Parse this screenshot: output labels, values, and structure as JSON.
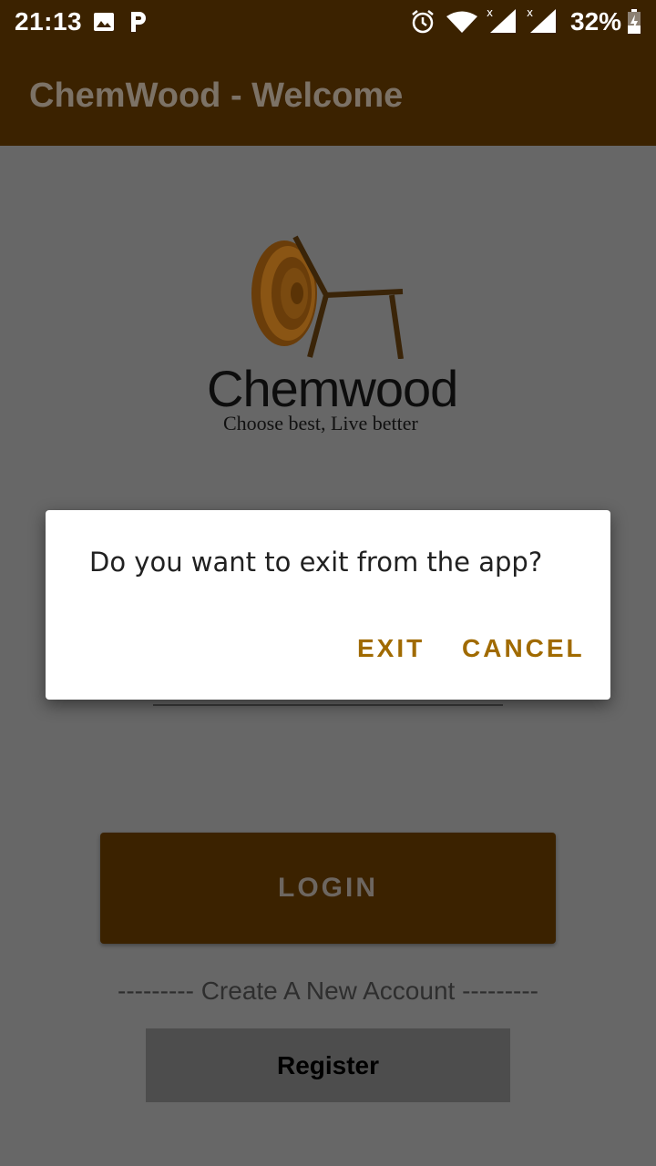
{
  "status_bar": {
    "time": "21:13",
    "battery_percent": "32%",
    "icons": [
      "image-icon",
      "parking-app-icon",
      "alarm-icon",
      "wifi-icon",
      "signal-icon",
      "signal-icon",
      "battery-charging-icon"
    ]
  },
  "app_bar": {
    "title": "ChemWood - Welcome"
  },
  "logo": {
    "wordmark": "Chemwood",
    "tagline": "Choose best, Live better"
  },
  "login": {
    "button_label": "LOGIN"
  },
  "create_account": {
    "text": "--------- Create A New Account ---------"
  },
  "register": {
    "button_label": "Register"
  },
  "dialog": {
    "message": "Do you want to exit from the app?",
    "exit_label": "EXIT",
    "cancel_label": "CANCEL"
  },
  "colors": {
    "primary_dark": "#3b2200",
    "accent": "#a06a00",
    "scrim_background": "#676767"
  }
}
